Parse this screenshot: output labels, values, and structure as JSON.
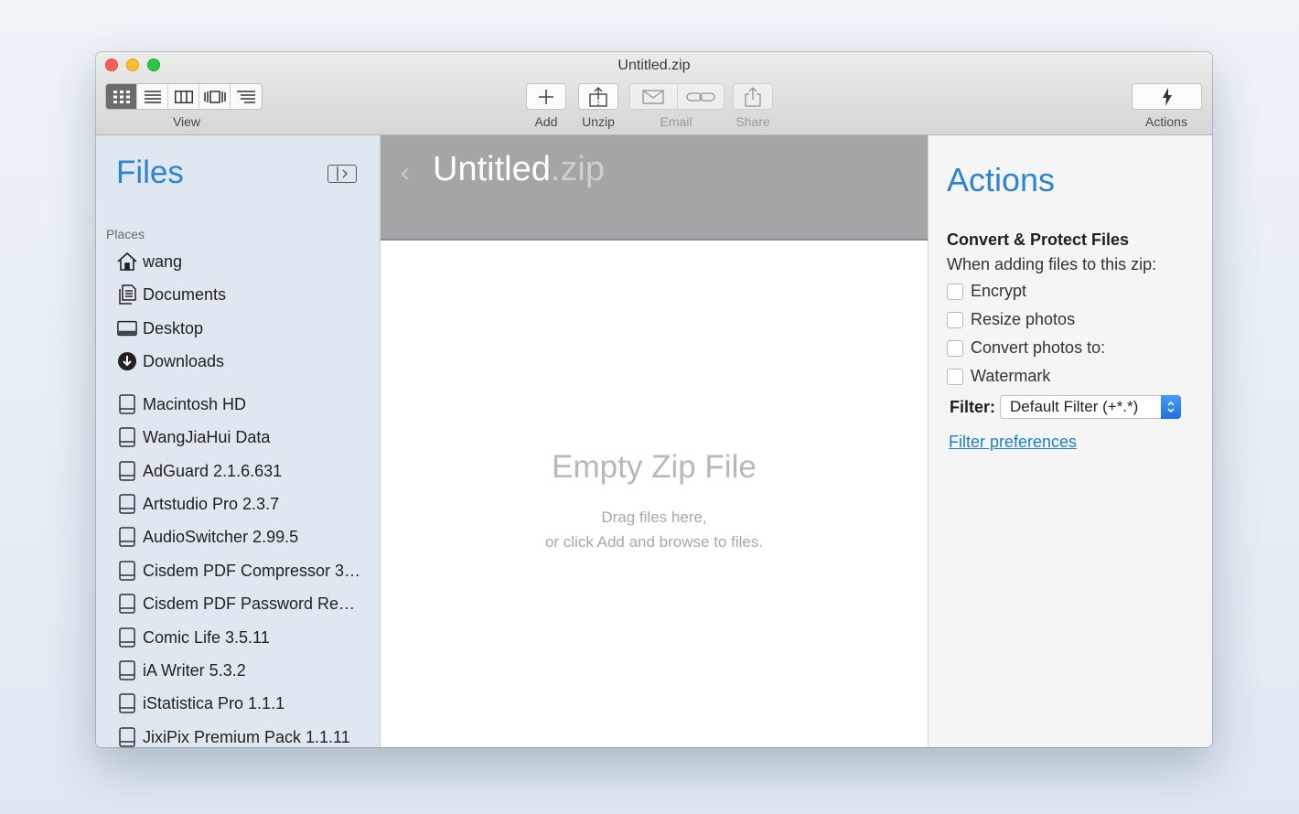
{
  "window": {
    "title": "Untitled.zip"
  },
  "toolbar": {
    "view_label": "View",
    "add_label": "Add",
    "unzip_label": "Unzip",
    "email_label": "Email",
    "share_label": "Share",
    "actions_label": "Actions",
    "view_modes": [
      "grid-icon",
      "list-icon",
      "columns-icon",
      "coverflow-icon",
      "outline-icon"
    ]
  },
  "sidebar": {
    "title": "Files",
    "section": "Places",
    "places": [
      {
        "label": "wang",
        "icon": "home-icon"
      },
      {
        "label": "Documents",
        "icon": "documents-icon"
      },
      {
        "label": "Desktop",
        "icon": "desktop-icon"
      },
      {
        "label": "Downloads",
        "icon": "downloads-icon"
      }
    ],
    "volumes": [
      "Macintosh HD",
      "WangJiaHui Data",
      "AdGuard 2.1.6.631",
      "Artstudio Pro 2.3.7",
      "AudioSwitcher 2.99.5",
      "Cisdem PDF Compressor 3…",
      "Cisdem PDF Password Re…",
      "Comic Life 3.5.11",
      "iA Writer 5.3.2",
      "iStatistica Pro 1.1.1",
      "JixiPix Premium Pack 1.1.11"
    ]
  },
  "main": {
    "title_name": "Untitled",
    "title_ext": ".zip",
    "empty_title": "Empty Zip File",
    "empty_line1": "Drag files here,",
    "empty_line2": "or click Add and browse to files."
  },
  "actions": {
    "title": "Actions",
    "heading": "Convert & Protect Files",
    "subheading": "When adding files to this zip:",
    "options": [
      "Encrypt",
      "Resize photos",
      "Convert photos to:",
      "Watermark"
    ],
    "filter_label": "Filter:",
    "filter_value": "Default Filter (+*.*)",
    "filter_link": "Filter preferences"
  },
  "colors": {
    "accent": "#2c84cf",
    "link": "#1a7fd4",
    "sidebar_bg": "#dfe7f1"
  }
}
